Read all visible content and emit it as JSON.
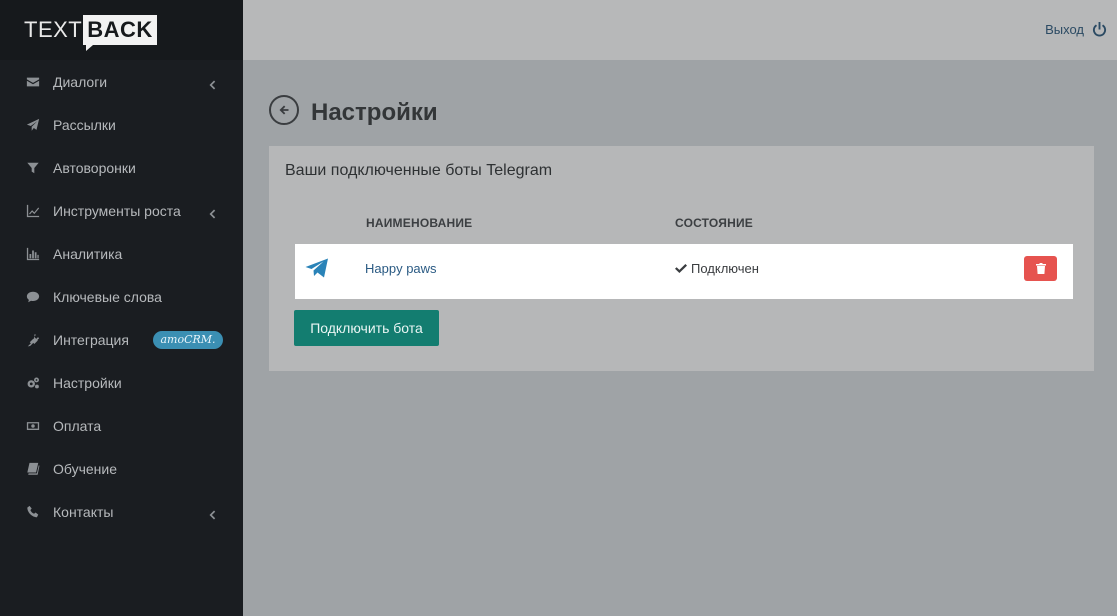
{
  "app": {
    "logo_part1": "TEXT",
    "logo_part2": "BACK"
  },
  "sidebar": {
    "items": [
      {
        "label": "Диалоги",
        "icon": "envelope-icon",
        "has_chevron": true
      },
      {
        "label": "Рассылки",
        "icon": "paper-plane-icon",
        "has_chevron": false
      },
      {
        "label": "Автоворонки",
        "icon": "funnel-icon",
        "has_chevron": false
      },
      {
        "label": "Инструменты роста",
        "icon": "line-chart-icon",
        "has_chevron": true
      },
      {
        "label": "Аналитика",
        "icon": "bar-chart-icon",
        "has_chevron": false
      },
      {
        "label": "Ключевые слова",
        "icon": "comment-icon",
        "has_chevron": false
      },
      {
        "label": "Интеграция",
        "icon": "plug-icon",
        "has_chevron": false,
        "badge": "amoCRM."
      },
      {
        "label": "Настройки",
        "icon": "gears-icon",
        "has_chevron": false
      },
      {
        "label": "Оплата",
        "icon": "money-icon",
        "has_chevron": false
      },
      {
        "label": "Обучение",
        "icon": "book-icon",
        "has_chevron": false
      },
      {
        "label": "Контакты",
        "icon": "phone-icon",
        "has_chevron": true
      }
    ]
  },
  "topbar": {
    "logout_label": "Выход",
    "logout_icon": "power-icon"
  },
  "page": {
    "title": "Настройки",
    "back_icon": "arrow-circle-left-icon"
  },
  "panel": {
    "title": "Ваши подключенные боты Telegram",
    "columns": {
      "name": "НАИМЕНОВАНИЕ",
      "state": "СОСТОЯНИЕ"
    },
    "bots": [
      {
        "name": "Happy paws",
        "state": "Подключен",
        "icon": "telegram-icon"
      }
    ],
    "connect_label": "Подключить бота"
  },
  "colors": {
    "sidebar_bg": "#1a1d21",
    "accent_button": "#137d70",
    "delete_button": "#e6534f",
    "telegram": "#2a83b8",
    "link": "#2a5a83"
  }
}
